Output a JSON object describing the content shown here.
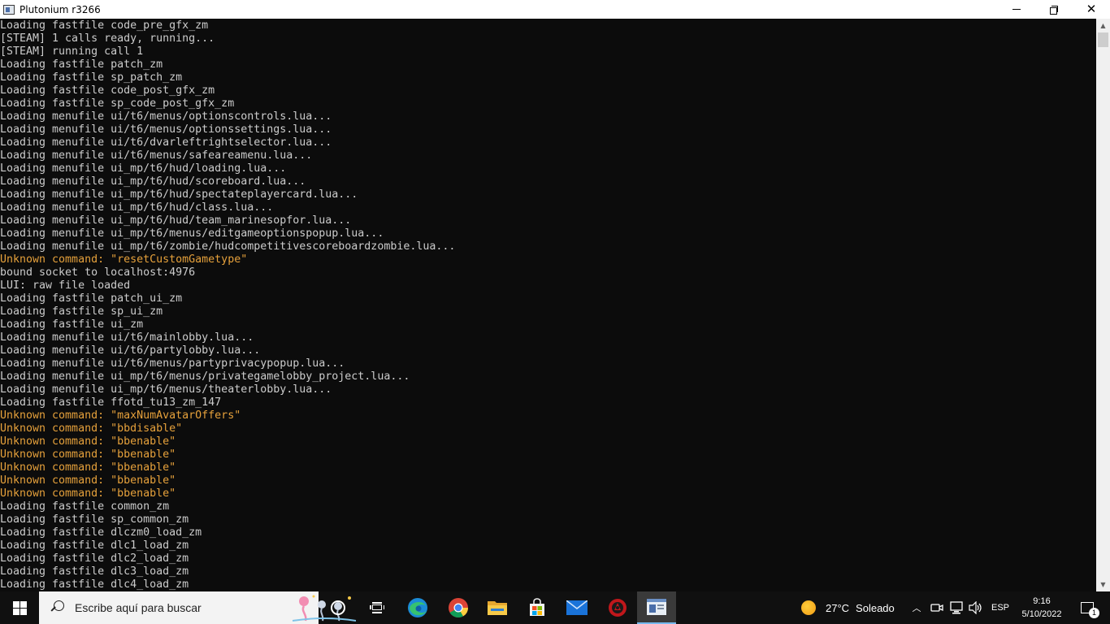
{
  "window": {
    "title": "Plutonium r3266"
  },
  "console": {
    "colors": {
      "normal": "#cccccc",
      "warning": "#e6a13b",
      "background": "#0c0c0c"
    },
    "lines": [
      {
        "text": "Loading fastfile code_pre_gfx_zm",
        "type": "normal"
      },
      {
        "text": "[STEAM] 1 calls ready, running...",
        "type": "normal"
      },
      {
        "text": "[STEAM] running call 1",
        "type": "normal"
      },
      {
        "text": "Loading fastfile patch_zm",
        "type": "normal"
      },
      {
        "text": "Loading fastfile sp_patch_zm",
        "type": "normal"
      },
      {
        "text": "Loading fastfile code_post_gfx_zm",
        "type": "normal"
      },
      {
        "text": "Loading fastfile sp_code_post_gfx_zm",
        "type": "normal"
      },
      {
        "text": "Loading menufile ui/t6/menus/optionscontrols.lua...",
        "type": "normal"
      },
      {
        "text": "Loading menufile ui/t6/menus/optionssettings.lua...",
        "type": "normal"
      },
      {
        "text": "Loading menufile ui/t6/dvarleftrightselector.lua...",
        "type": "normal"
      },
      {
        "text": "Loading menufile ui/t6/menus/safeareamenu.lua...",
        "type": "normal"
      },
      {
        "text": "Loading menufile ui_mp/t6/hud/loading.lua...",
        "type": "normal"
      },
      {
        "text": "Loading menufile ui_mp/t6/hud/scoreboard.lua...",
        "type": "normal"
      },
      {
        "text": "Loading menufile ui_mp/t6/hud/spectateplayercard.lua...",
        "type": "normal"
      },
      {
        "text": "Loading menufile ui_mp/t6/hud/class.lua...",
        "type": "normal"
      },
      {
        "text": "Loading menufile ui_mp/t6/hud/team_marinesopfor.lua...",
        "type": "normal"
      },
      {
        "text": "Loading menufile ui_mp/t6/menus/editgameoptionspopup.lua...",
        "type": "normal"
      },
      {
        "text": "Loading menufile ui_mp/t6/zombie/hudcompetitivescoreboardzombie.lua...",
        "type": "normal"
      },
      {
        "text": "Unknown command: \"resetCustomGametype\"",
        "type": "warning"
      },
      {
        "text": "bound socket to localhost:4976",
        "type": "normal"
      },
      {
        "text": "LUI: raw file loaded",
        "type": "normal"
      },
      {
        "text": "Loading fastfile patch_ui_zm",
        "type": "normal"
      },
      {
        "text": "Loading fastfile sp_ui_zm",
        "type": "normal"
      },
      {
        "text": "Loading fastfile ui_zm",
        "type": "normal"
      },
      {
        "text": "Loading menufile ui/t6/mainlobby.lua...",
        "type": "normal"
      },
      {
        "text": "Loading menufile ui/t6/partylobby.lua...",
        "type": "normal"
      },
      {
        "text": "Loading menufile ui/t6/menus/partyprivacypopup.lua...",
        "type": "normal"
      },
      {
        "text": "Loading menufile ui_mp/t6/menus/privategamelobby_project.lua...",
        "type": "normal"
      },
      {
        "text": "Loading menufile ui_mp/t6/menus/theaterlobby.lua...",
        "type": "normal"
      },
      {
        "text": "Loading fastfile ffotd_tu13_zm_147",
        "type": "normal"
      },
      {
        "text": "Unknown command: \"maxNumAvatarOffers\"",
        "type": "warning"
      },
      {
        "text": "Unknown command: \"bbdisable\"",
        "type": "warning"
      },
      {
        "text": "Unknown command: \"bbenable\"",
        "type": "warning"
      },
      {
        "text": "Unknown command: \"bbenable\"",
        "type": "warning"
      },
      {
        "text": "Unknown command: \"bbenable\"",
        "type": "warning"
      },
      {
        "text": "Unknown command: \"bbenable\"",
        "type": "warning"
      },
      {
        "text": "Unknown command: \"bbenable\"",
        "type": "warning"
      },
      {
        "text": "Loading fastfile common_zm",
        "type": "normal"
      },
      {
        "text": "Loading fastfile sp_common_zm",
        "type": "normal"
      },
      {
        "text": "Loading fastfile dlczm0_load_zm",
        "type": "normal"
      },
      {
        "text": "Loading fastfile dlc1_load_zm",
        "type": "normal"
      },
      {
        "text": "Loading fastfile dlc2_load_zm",
        "type": "normal"
      },
      {
        "text": "Loading fastfile dlc3_load_zm",
        "type": "normal"
      },
      {
        "text": "Loading fastfile dlc4_load_zm",
        "type": "normal"
      }
    ]
  },
  "taskbar": {
    "search_placeholder": "Escribe aquí para buscar",
    "apps": [
      {
        "name": "edge-icon"
      },
      {
        "name": "chrome-icon"
      },
      {
        "name": "file-explorer-icon"
      },
      {
        "name": "microsoft-store-icon"
      },
      {
        "name": "mail-icon"
      },
      {
        "name": "plutonium-icon"
      },
      {
        "name": "console-app-icon"
      }
    ],
    "weather": {
      "temp": "27°C",
      "condition": "Soleado"
    },
    "language": "ESP",
    "time": "9:16",
    "date": "5/10/2022",
    "notification_count": "1"
  }
}
